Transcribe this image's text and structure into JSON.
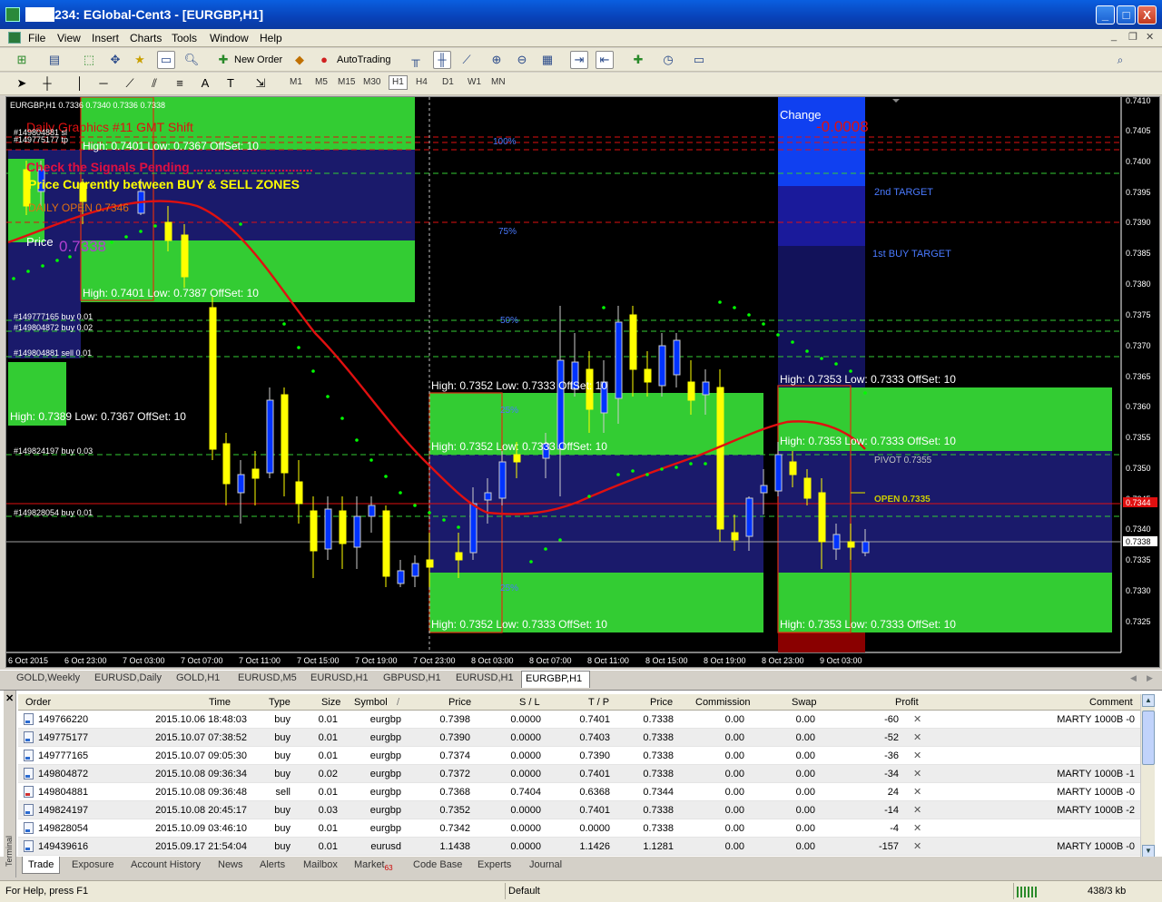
{
  "window": {
    "title": "234: EGlobal-Cent3 - [EURGBP,H1]",
    "buttons": [
      "_",
      "□",
      "X"
    ]
  },
  "menu": [
    "File",
    "View",
    "Insert",
    "Charts",
    "Tools",
    "Window",
    "Help"
  ],
  "toolbar": {
    "new_order": "New Order",
    "autotrading": "AutoTrading",
    "timeframes": [
      "M1",
      "M5",
      "M15",
      "M30",
      "H1",
      "H4",
      "D1",
      "W1",
      "MN"
    ],
    "active_timeframe": "H1",
    "search_placeholder": ""
  },
  "chart": {
    "symbol_info": "EURGBP,H1  0.7336 0.7340 0.7336 0.7338",
    "colors": {
      "bg": "#000000",
      "zone": "#33cc33",
      "mid_zone": "#1a1a6b",
      "bull_candle": "#ffff00",
      "bear_candle": "#0033ff",
      "ma": "#e01010",
      "sar": "#00ff00"
    },
    "overlay_texts": {
      "daily_graphics": "Daily Graphics #11 GMT Shift",
      "signals": "Check the Signals Pending ..................................",
      "price_zone": "Price Currently between BUY & SELL ZONES",
      "daily_open": "DAILY OPEN    0.7346",
      "price_label": "Price",
      "price_value": "0.7338",
      "change_label": "Change",
      "change_value": "-0.0008",
      "second_target": "2nd TARGET",
      "first_target": "1st BUY TARGET",
      "pivot": "PIVOT 0.7355",
      "open": "OPEN 0.7335",
      "pct_100": "100%",
      "pct_75": "75%",
      "pct_50": "50%",
      "pct_25a": "25%",
      "pct_25b": "25%"
    },
    "zone_labels": [
      "High: 0.7401   Low: 0.7367 OffSet: 10",
      "High: 0.7401   Low: 0.7387 OffSet: 10",
      "High: 0.7389   Low: 0.7367 OffSet: 10",
      "High: 0.7352   Low: 0.7333 OffSet: 10",
      "High: 0.7352   Low: 0.7333 OffSet: 10",
      "High: 0.7352   Low: 0.7333 OffSet: 10",
      "High: 0.7353   Low: 0.7333 OffSet: 10",
      "High: 0.7353   Low: 0.7333 OffSet: 10",
      "High: 0.7353   Low: 0.7333 OffSet: 10"
    ],
    "order_lines": [
      "#149804881 sl",
      "#149775177 tp",
      "#149777165 buy 0.01",
      "#149804872 buy 0.02",
      "#149804881 sell 0.01",
      "#149824197 buy 0.03",
      "#149828054 buy 0.01"
    ],
    "price_axis": [
      "0.7410",
      "0.7405",
      "0.7400",
      "0.7395",
      "0.7390",
      "0.7385",
      "0.7380",
      "0.7375",
      "0.7370",
      "0.7365",
      "0.7360",
      "0.7355",
      "0.7350",
      "0.7345",
      "0.7340",
      "0.7335",
      "0.7330",
      "0.7325"
    ],
    "current_price": "0.7338",
    "sell_price_tag": "0.7344",
    "time_axis": [
      "6 Oct 2015",
      "6 Oct 23:00",
      "7 Oct 03:00",
      "7 Oct 07:00",
      "7 Oct 11:00",
      "7 Oct 15:00",
      "7 Oct 19:00",
      "7 Oct 23:00",
      "8 Oct 03:00",
      "8 Oct 07:00",
      "8 Oct 11:00",
      "8 Oct 15:00",
      "8 Oct 19:00",
      "8 Oct 23:00",
      "9 Oct 03:00"
    ]
  },
  "chart_tabs": [
    "GOLD,Weekly",
    "EURUSD,Daily",
    "GOLD,H1",
    "EURUSD,M5",
    "EURUSD,H1",
    "GBPUSD,H1",
    "EURUSD,H1",
    "EURGBP,H1"
  ],
  "active_chart_tab": "EURGBP,H1",
  "terminal": {
    "side_label": "Terminal",
    "columns": [
      "Order",
      "Time",
      "Type",
      "Size",
      "Symbol",
      "Price",
      "S / L",
      "T / P",
      "Price",
      "Commission",
      "Swap",
      "Profit",
      "Comment"
    ],
    "sort_indicator": "/",
    "rows": [
      {
        "order": "149766220",
        "time": "2015.10.06 18:48:03",
        "type": "buy",
        "size": "0.01",
        "symbol": "eurgbp",
        "price": "0.7398",
        "sl": "0.0000",
        "tp": "0.7401",
        "cur": "0.7338",
        "commission": "0.00",
        "swap": "0.00",
        "profit": "-60",
        "comment": "MARTY 1000B -0"
      },
      {
        "order": "149775177",
        "time": "2015.10.07 07:38:52",
        "type": "buy",
        "size": "0.01",
        "symbol": "eurgbp",
        "price": "0.7390",
        "sl": "0.0000",
        "tp": "0.7403",
        "cur": "0.7338",
        "commission": "0.00",
        "swap": "0.00",
        "profit": "-52",
        "comment": ""
      },
      {
        "order": "149777165",
        "time": "2015.10.07 09:05:30",
        "type": "buy",
        "size": "0.01",
        "symbol": "eurgbp",
        "price": "0.7374",
        "sl": "0.0000",
        "tp": "0.7390",
        "cur": "0.7338",
        "commission": "0.00",
        "swap": "0.00",
        "profit": "-36",
        "comment": ""
      },
      {
        "order": "149804872",
        "time": "2015.10.08 09:36:34",
        "type": "buy",
        "size": "0.02",
        "symbol": "eurgbp",
        "price": "0.7372",
        "sl": "0.0000",
        "tp": "0.7401",
        "cur": "0.7338",
        "commission": "0.00",
        "swap": "0.00",
        "profit": "-34",
        "comment": "MARTY 1000B -1"
      },
      {
        "order": "149804881",
        "time": "2015.10.08 09:36:48",
        "type": "sell",
        "size": "0.01",
        "symbol": "eurgbp",
        "price": "0.7368",
        "sl": "0.7404",
        "tp": "0.6368",
        "cur": "0.7344",
        "commission": "0.00",
        "swap": "0.00",
        "profit": "24",
        "comment": "MARTY 1000B -0"
      },
      {
        "order": "149824197",
        "time": "2015.10.08 20:45:17",
        "type": "buy",
        "size": "0.03",
        "symbol": "eurgbp",
        "price": "0.7352",
        "sl": "0.0000",
        "tp": "0.7401",
        "cur": "0.7338",
        "commission": "0.00",
        "swap": "0.00",
        "profit": "-14",
        "comment": "MARTY 1000B -2"
      },
      {
        "order": "149828054",
        "time": "2015.10.09 03:46:10",
        "type": "buy",
        "size": "0.01",
        "symbol": "eurgbp",
        "price": "0.7342",
        "sl": "0.0000",
        "tp": "0.0000",
        "cur": "0.7338",
        "commission": "0.00",
        "swap": "0.00",
        "profit": "-4",
        "comment": ""
      },
      {
        "order": "149439616",
        "time": "2015.09.17 21:54:04",
        "type": "buy",
        "size": "0.01",
        "symbol": "eurusd",
        "price": "1.1438",
        "sl": "0.0000",
        "tp": "1.1426",
        "cur": "1.1281",
        "commission": "0.00",
        "swap": "0.00",
        "profit": "-157",
        "comment": "MARTY 1000B -0"
      }
    ],
    "tabs": [
      "Trade",
      "Exposure",
      "Account History",
      "News",
      "Alerts",
      "Mailbox",
      "Market",
      "Code Base",
      "Experts",
      "Journal"
    ],
    "market_badge": "63",
    "active_tab": "Trade"
  },
  "status": {
    "help": "For Help, press F1",
    "profile": "Default",
    "traffic": "438/3 kb"
  }
}
